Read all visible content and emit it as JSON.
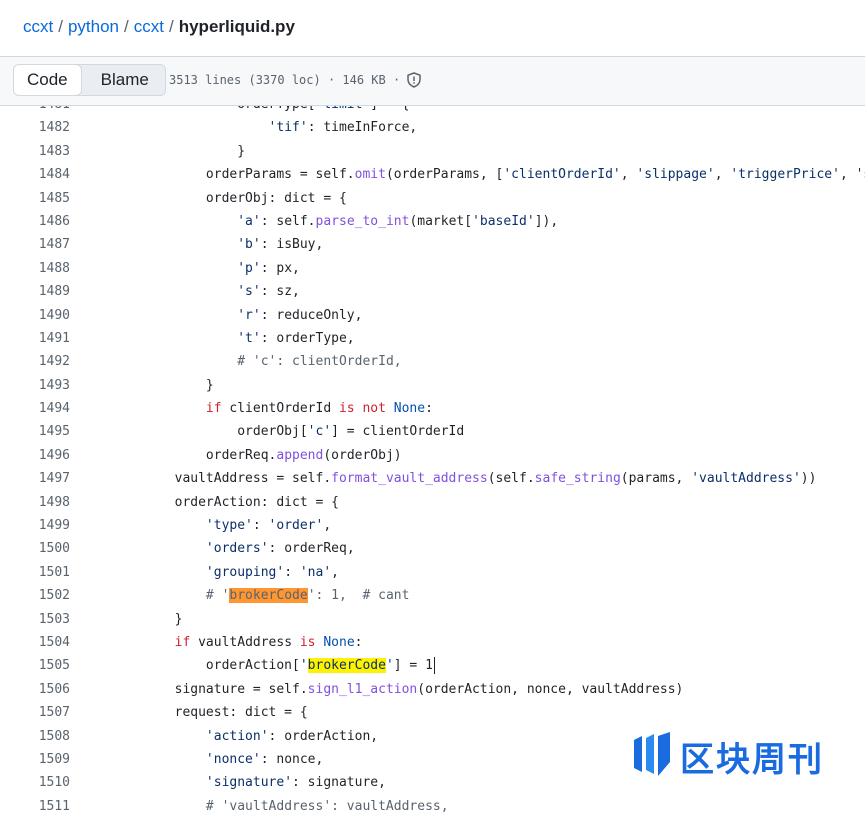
{
  "breadcrumb": {
    "items": [
      "ccxt",
      "python",
      "ccxt"
    ],
    "separator": "/",
    "file": "hyperliquid.py"
  },
  "toolbar": {
    "code_label": "Code",
    "blame_label": "Blame",
    "meta": "3513 lines (3370 loc) · 146 KB ·"
  },
  "code": {
    "lines": [
      {
        "n": "1481",
        "t": "                orderType['limit'] = {"
      },
      {
        "n": "1482",
        "t": "                    'tif': timeInForce,"
      },
      {
        "n": "1483",
        "t": "                }"
      },
      {
        "n": "1484",
        "t": "            orderParams = self.omit(orderParams, ['clientOrderId', 'slippage', 'triggerPrice', 'st"
      },
      {
        "n": "1485",
        "t": "            orderObj: dict = {"
      },
      {
        "n": "1486",
        "t": "                'a': self.parse_to_int(market['baseId']),"
      },
      {
        "n": "1487",
        "t": "                'b': isBuy,"
      },
      {
        "n": "1488",
        "t": "                'p': px,"
      },
      {
        "n": "1489",
        "t": "                's': sz,"
      },
      {
        "n": "1490",
        "t": "                'r': reduceOnly,"
      },
      {
        "n": "1491",
        "t": "                't': orderType,"
      },
      {
        "n": "1492",
        "t": "                # 'c': clientOrderId,"
      },
      {
        "n": "1493",
        "t": "            }"
      },
      {
        "n": "1494",
        "t": "            if clientOrderId is not None:"
      },
      {
        "n": "1495",
        "t": "                orderObj['c'] = clientOrderId"
      },
      {
        "n": "1496",
        "t": "            orderReq.append(orderObj)"
      },
      {
        "n": "1497",
        "t": "        vaultAddress = self.format_vault_address(self.safe_string(params, 'vaultAddress'))"
      },
      {
        "n": "1498",
        "t": "        orderAction: dict = {"
      },
      {
        "n": "1499",
        "t": "            'type': 'order',"
      },
      {
        "n": "1500",
        "t": "            'orders': orderReq,"
      },
      {
        "n": "1501",
        "t": "            'grouping': 'na',"
      },
      {
        "n": "1502",
        "t": "            # 'brokerCode': 1,  # cant"
      },
      {
        "n": "1503",
        "t": "        }"
      },
      {
        "n": "1504",
        "t": "        if vaultAddress is None:"
      },
      {
        "n": "1505",
        "t": "            orderAction['brokerCode'] = 1"
      },
      {
        "n": "1506",
        "t": "        signature = self.sign_l1_action(orderAction, nonce, vaultAddress)"
      },
      {
        "n": "1507",
        "t": "        request: dict = {"
      },
      {
        "n": "1508",
        "t": "            'action': orderAction,"
      },
      {
        "n": "1509",
        "t": "            'nonce': nonce,"
      },
      {
        "n": "1510",
        "t": "            'signature': signature,"
      },
      {
        "n": "1511",
        "t": "            # 'vaultAddress': vaultAddress,"
      }
    ],
    "highlight_word": "brokerCode",
    "highlight_colors": {
      "current": "#ff9632",
      "other": "#fff200"
    }
  },
  "watermark": {
    "text": "区块周刊",
    "logo": "blockweekly-logo-icon",
    "color": "#1a6be0"
  },
  "icons": {
    "shield": "shield-icon"
  }
}
